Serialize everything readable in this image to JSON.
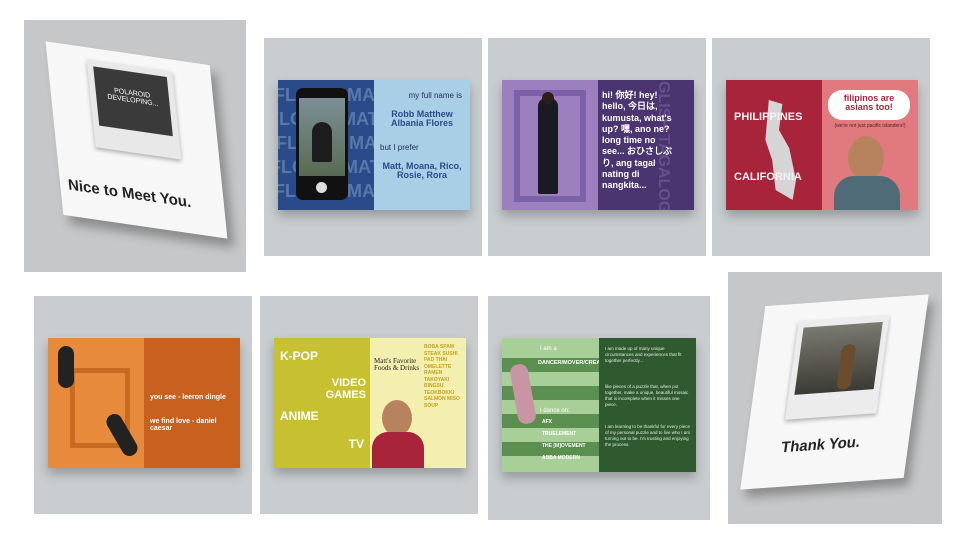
{
  "cover": {
    "badge_line1": "POLAROID",
    "badge_line2": "DEVELOPING...",
    "title": "Nice to Meet You."
  },
  "spread1": {
    "side_word": "FLORESMATT",
    "intro": "my full name is",
    "name": "Robb Matthew Albania Flores",
    "prefer": "but I prefer",
    "nicknames": "Matt, Moana, Rico, Rosie, Rora"
  },
  "spread2": {
    "greeting": "hi! 你好! hey! hello, 今日は, kumusta, what's up? 嘿, ano ne? long time no see... おひさしぶり, ang tagal nating di nangkita...",
    "side_word": "ENGLISH TAGALOG"
  },
  "spread3": {
    "country": "PHILIPPINES",
    "state": "CALIFORNIA",
    "headline": "filipinos are asians too!",
    "subline": "(we're not just pacific islanders!)"
  },
  "spread4": {
    "lyric1": "you see - leeron dingle",
    "lyric2": "we find love - daniel caesar"
  },
  "spread5": {
    "kpop": "K-POP",
    "games": "VIDEO GAMES",
    "anime": "ANIME",
    "tv": "TV",
    "foods_title": "Matt's Favorite Foods & Drinks",
    "foods": "BOBA SPAM STEAK SUSHI PAD THAI OMELETTE RAMEN TAKOYAKI BINGSU TEOKBOKKI SALMON MISO SOUP"
  },
  "spread6": {
    "intro": "I am a",
    "roles": "DANCER/MOVER/CREATOR/ARTIST/DIRECTOR/VIDEOGRAPHER",
    "dance_on": "I dance on:",
    "teams": [
      "AFX",
      "TRUELEMENT",
      "THE [M]OVEMENT",
      "ABBA MODERN"
    ],
    "quote1": "I am made up of many unique circumstances and experiences that fit together perfectly...",
    "quote2": "like pieces of a puzzle that, when put together, make a unique, beautiful mosaic that is incomplete when it misses one piece.",
    "quote3": "I am learning to be thankful for every piece of my personal puzzle and to live who I am turning out to be. I'm trusting and enjoying the process."
  },
  "back": {
    "title": "Thank You."
  },
  "colors": {
    "panel": "#c9cdcf",
    "blue": "#2b4a8a",
    "light_blue": "#a9cfe6",
    "purple": "#9b7fbf",
    "dark_purple": "#4a3570",
    "red": "#a8243a",
    "pink": "#e07a7e",
    "orange": "#e88a3c",
    "yellow": "#c7c030",
    "green": "#5b8f4f",
    "dark_green": "#2f5a2f"
  }
}
